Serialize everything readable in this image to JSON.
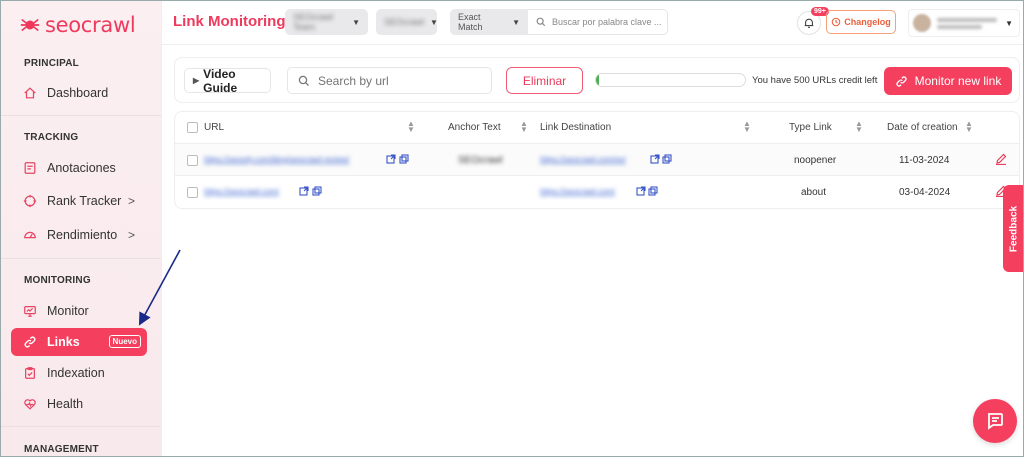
{
  "app": {
    "logo_text": "seocrawl",
    "page_title": "Link Monitoring"
  },
  "sidebar": {
    "sections": {
      "principal": "PRINCIPAL",
      "tracking": "TRACKING",
      "monitoring": "MONITORING",
      "management": "MANAGEMENT"
    },
    "items": [
      {
        "label": "Dashboard",
        "icon": "home-icon"
      },
      {
        "label": "Anotaciones",
        "icon": "note-icon"
      },
      {
        "label": "Rank Tracker",
        "icon": "target-icon",
        "chevron": ">"
      },
      {
        "label": "Rendimiento",
        "icon": "gauge-icon",
        "chevron": ">"
      },
      {
        "label": "Monitor",
        "icon": "monitor-icon"
      },
      {
        "label": "Links",
        "icon": "link-icon",
        "badge": "Nuevo",
        "active": true
      },
      {
        "label": "Indexation",
        "icon": "clipboard-icon"
      },
      {
        "label": "Health",
        "icon": "heart-icon"
      }
    ]
  },
  "topbar": {
    "project_select": "SEOcrawl Team",
    "country_select": "SEOcrawl",
    "match_select": "Exact Match",
    "keyword_search_placeholder": "Buscar por palabra clave ...",
    "notifications_badge": "99+",
    "changelog_label": "Changelog"
  },
  "toolbar": {
    "video_guide_label": "Video Guide",
    "search_placeholder": "Search by url",
    "delete_label": "Eliminar",
    "credit_progress": 0.02,
    "credit_text": "You have 500 URLs credit left",
    "monitor_label": "Monitor new link"
  },
  "table": {
    "headers": {
      "url": "URL",
      "anchor": "Anchor Text",
      "destination": "Link Destination",
      "type": "Type Link",
      "date": "Date of creation"
    },
    "rows": [
      {
        "url": "https://seoxdy.com/blog/seocrawl-review/",
        "anchor": "SEOcrawl",
        "destination": "https://seocrawl.com/es/",
        "type": "noopener",
        "date": "11-03-2024"
      },
      {
        "url": "https://seocrawl.com/",
        "anchor": "",
        "destination": "https://seocrawl.com/",
        "type": "about",
        "date": "03-04-2024"
      }
    ]
  },
  "feedback_label": "Feedback",
  "colors": {
    "accent": "#f43f5e",
    "changelog": "#e8603c",
    "arrow": "#1a2a8a"
  }
}
